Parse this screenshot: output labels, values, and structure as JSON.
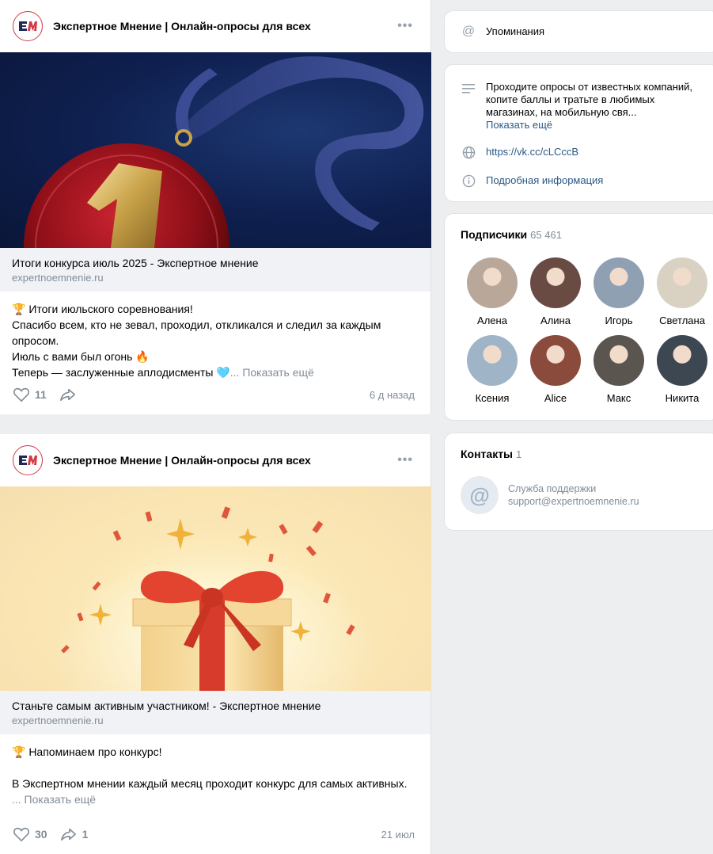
{
  "posts": [
    {
      "author": "Экспертное Мнение | Онлайн-опросы для всех",
      "link_title": "Итоги конкурса июль 2025 - Экспертное мнение",
      "link_domain": "expertnoemnenie.ru",
      "text_lines": [
        "🏆 Итоги июльского соревнования!",
        "Спасибо всем, кто не зевал, проходил, откликался и следил за каждым опросом.",
        "Июль с вами был огонь 🔥",
        "Теперь — заслуженные аплодисменты 🩵"
      ],
      "show_more": "... Показать ещё",
      "likes": "11",
      "shares": "",
      "date": "6 д назад"
    },
    {
      "author": "Экспертное Мнение | Онлайн-опросы для всех",
      "link_title": "Станьте самым активным участником! - Экспертное мнение",
      "link_domain": "expertnoemnenie.ru",
      "text_lines": [
        "🏆 Напоминаем про конкурс!",
        "",
        "В Экспертном мнении каждый месяц проходит конкурс для самых активных."
      ],
      "show_more": "... Показать ещё",
      "likes": "30",
      "shares": "1",
      "date": "21 июл"
    }
  ],
  "sidebar": {
    "mentions": "Упоминания",
    "info": {
      "description": "Проходите опросы от известных компаний, копите баллы и тратьте в любимых магазинах, на мобильную свя...",
      "show_more": "Показать ещё",
      "url": "https://vk.cc/cLCccB",
      "details": "Подробная информация"
    },
    "subscribers": {
      "title": "Подписчики",
      "count": "65 461",
      "people": [
        {
          "name": "Алена",
          "color": "#b9a89a"
        },
        {
          "name": "Алина",
          "color": "#6a4b44"
        },
        {
          "name": "Игорь",
          "color": "#8fa0b3"
        },
        {
          "name": "Светлана",
          "color": "#d9d2c3"
        },
        {
          "name": "Ксения",
          "color": "#9fb4c7"
        },
        {
          "name": "Alice",
          "color": "#8a4a3c"
        },
        {
          "name": "Макс",
          "color": "#5b5550"
        },
        {
          "name": "Никита",
          "color": "#3d4752"
        }
      ]
    },
    "contacts": {
      "title": "Контакты",
      "count": "1",
      "items": [
        {
          "role": "Служба поддержки",
          "email": "support@expertnoemnenie.ru"
        }
      ]
    }
  }
}
